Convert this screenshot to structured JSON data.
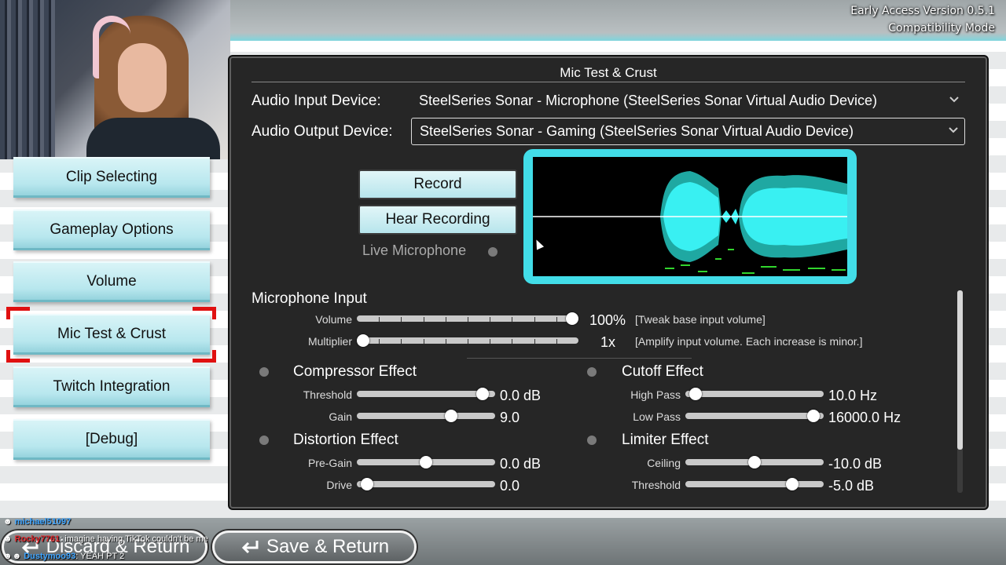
{
  "version": {
    "line1": "Early Access Version 0.5.1",
    "line2": "Compatibility Mode"
  },
  "sidebar": {
    "items": [
      {
        "label": "Clip Selecting"
      },
      {
        "label": "Gameplay Options"
      },
      {
        "label": "Volume"
      },
      {
        "label": "Mic Test & Crust"
      },
      {
        "label": "Twitch Integration"
      },
      {
        "label": "[Debug]"
      }
    ],
    "selected_index": 3
  },
  "panel": {
    "title": "Mic Test & Crust",
    "input_device_label": "Audio Input Device:",
    "input_device_value": "SteelSeries Sonar - Microphone (SteelSeries Sonar Virtual Audio Device)",
    "output_device_label": "Audio Output Device:",
    "output_device_value": "SteelSeries Sonar - Gaming (SteelSeries Sonar Virtual Audio Device)",
    "record_label": "Record",
    "hear_label": "Hear Recording",
    "live_mic_label": "Live Microphone",
    "mic_input": {
      "title": "Microphone Input",
      "volume_label": "Volume",
      "volume_value": "100%",
      "volume_level": 1.0,
      "volume_note": "[Tweak base input volume]",
      "multiplier_label": "Multiplier",
      "multiplier_value": "1x",
      "multiplier_level": 0.0,
      "multiplier_note": "[Amplify input volume. Each increase is minor.]"
    },
    "compressor": {
      "title": "Compressor Effect",
      "threshold_label": "Threshold",
      "threshold_value": "0.0 dB",
      "threshold_level": 0.95,
      "gain_label": "Gain",
      "gain_value": "9.0",
      "gain_level": 0.7
    },
    "cutoff": {
      "title": "Cutoff Effect",
      "highpass_label": "High Pass",
      "highpass_value": "10.0 Hz",
      "highpass_level": 0.03,
      "lowpass_label": "Low Pass",
      "lowpass_value": "16000.0 Hz",
      "lowpass_level": 0.97
    },
    "distortion": {
      "title": "Distortion Effect",
      "pregain_label": "Pre-Gain",
      "pregain_value": "0.0 dB",
      "pregain_level": 0.5,
      "drive_label": "Drive",
      "drive_value": "0.0",
      "drive_level": 0.03
    },
    "limiter": {
      "title": "Limiter Effect",
      "ceiling_label": "Ceiling",
      "ceiling_value": "-10.0 dB",
      "ceiling_level": 0.5,
      "threshold_label": "Threshold",
      "threshold_value": "-5.0 dB",
      "threshold_level": 0.8
    }
  },
  "bottom": {
    "discard_label": "Discard & Return",
    "save_label": "Save & Return"
  },
  "chat": [
    {
      "user": "michael51097",
      "text": ""
    },
    {
      "user": "Rocky7761",
      "text": ": imagine having TikTok couldn't be me"
    },
    {
      "user": "Dustymoo93",
      "text": ": YEAH PT 2"
    }
  ],
  "colors": {
    "accent": "#42dde8",
    "button": "#b7e5ec",
    "selection": "#e01010",
    "panel": "#262626"
  }
}
